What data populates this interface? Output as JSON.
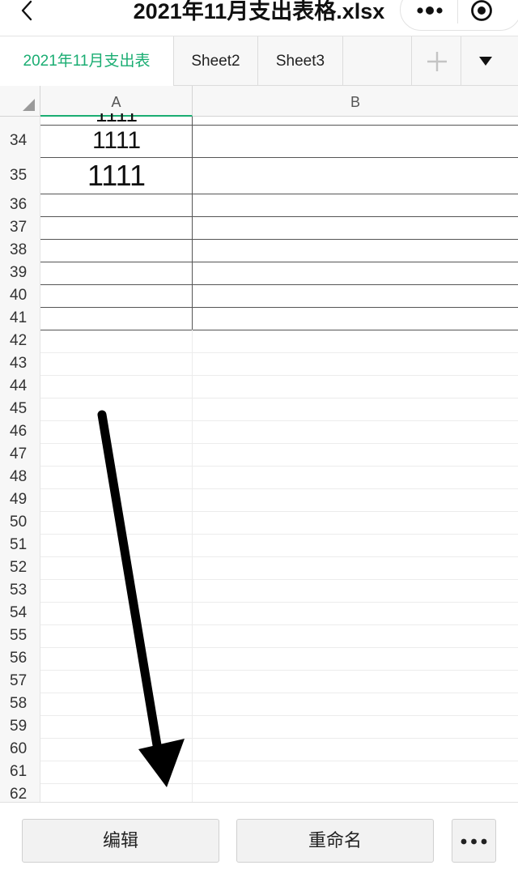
{
  "window": {
    "title": "2021年11月支出表格.xlsx"
  },
  "icons": {
    "back": "chevron-left-icon",
    "more": "more-dots-icon",
    "target": "target-icon",
    "add_sheet": "plus-icon",
    "sheet_menu": "triangle-down-icon",
    "select_all": "corner-triangle-icon",
    "overflow": "ellipsis-icon"
  },
  "colors": {
    "accent": "#1aad72",
    "header_bg": "#f7f7f7",
    "grid_line_dark": "#555555",
    "grid_line_light": "#ececec"
  },
  "tabs": [
    {
      "label": "2021年11月支出表",
      "active": true
    },
    {
      "label": "Sheet2",
      "active": false
    },
    {
      "label": "Sheet3",
      "active": false
    }
  ],
  "grid": {
    "columns": [
      "A",
      "B"
    ],
    "rows": [
      {
        "num": "34",
        "a": "1111"
      },
      {
        "num": "35",
        "a": "1111"
      },
      {
        "num": "36",
        "a": ""
      },
      {
        "num": "37",
        "a": ""
      },
      {
        "num": "38",
        "a": ""
      },
      {
        "num": "39",
        "a": ""
      },
      {
        "num": "40",
        "a": ""
      },
      {
        "num": "41",
        "a": ""
      },
      {
        "num": "42",
        "a": ""
      },
      {
        "num": "43",
        "a": ""
      },
      {
        "num": "44",
        "a": ""
      },
      {
        "num": "45",
        "a": ""
      },
      {
        "num": "46",
        "a": ""
      },
      {
        "num": "47",
        "a": ""
      },
      {
        "num": "48",
        "a": ""
      },
      {
        "num": "49",
        "a": ""
      },
      {
        "num": "50",
        "a": ""
      },
      {
        "num": "51",
        "a": ""
      },
      {
        "num": "52",
        "a": ""
      },
      {
        "num": "53",
        "a": ""
      },
      {
        "num": "54",
        "a": ""
      },
      {
        "num": "55",
        "a": ""
      },
      {
        "num": "56",
        "a": ""
      },
      {
        "num": "57",
        "a": ""
      },
      {
        "num": "58",
        "a": ""
      },
      {
        "num": "59",
        "a": ""
      },
      {
        "num": "60",
        "a": ""
      },
      {
        "num": "61",
        "a": ""
      },
      {
        "num": "62",
        "a": ""
      }
    ]
  },
  "bottom_bar": {
    "edit_label": "编辑",
    "rename_label": "重命名"
  }
}
